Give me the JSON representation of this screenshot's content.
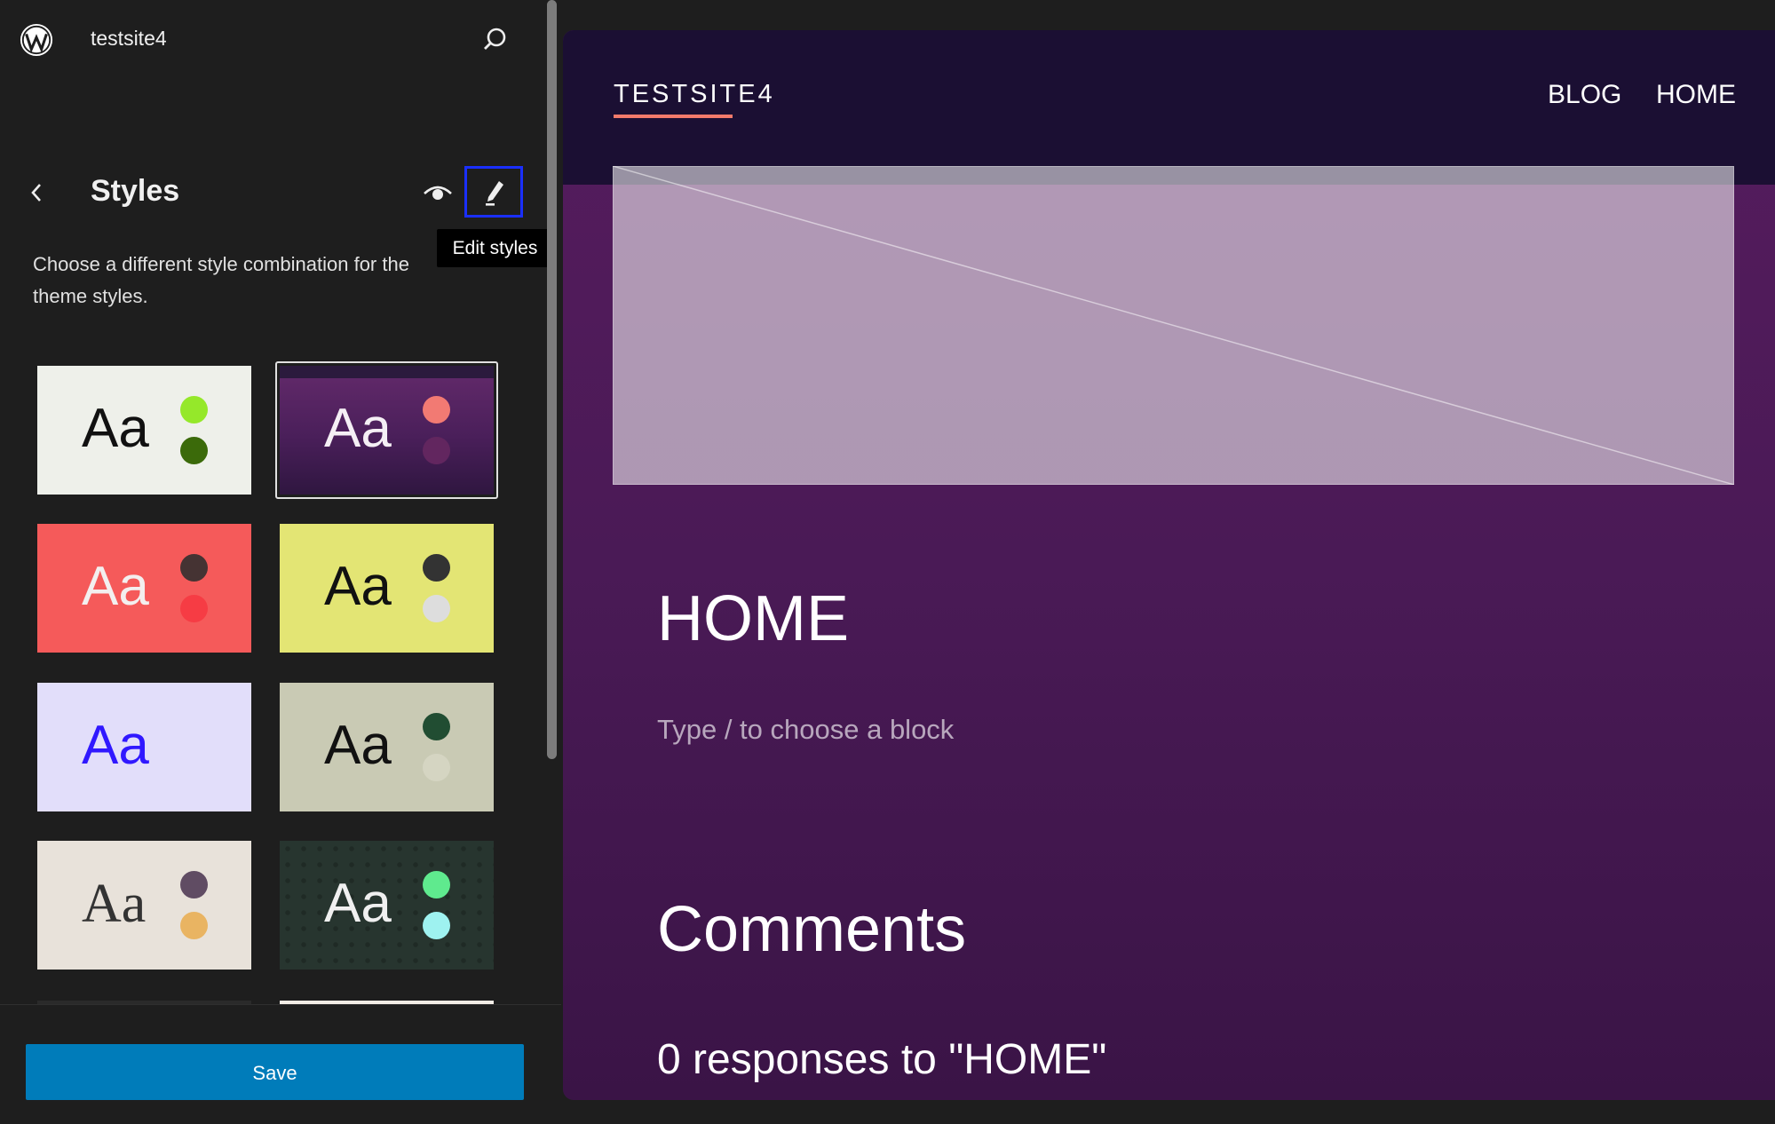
{
  "sidebar": {
    "site_name": "testsite4",
    "title": "Styles",
    "description": "Choose a different style combination for the theme styles.",
    "tooltip": "Edit styles",
    "save_label": "Save",
    "icons": {
      "logo": "wordpress-logo",
      "search": "search-icon",
      "back": "chevron-left-icon",
      "preview": "eye-icon",
      "edit": "pencil-icon"
    },
    "style_variations": [
      {
        "label": "Aa",
        "bg": "#eef0ea",
        "text": "#111111",
        "dots": [
          "#95e82a",
          "#3b6a0a"
        ]
      },
      {
        "label": "Aa",
        "bg": "#4a1f5a",
        "text": "#f5eff5",
        "dots": [
          "#f27a73",
          "#62265f"
        ],
        "selected": true
      },
      {
        "label": "Aa",
        "bg": "#f55a5a",
        "text": "#f3efef",
        "dots": [
          "#453333",
          "#f63c44"
        ]
      },
      {
        "label": "Aa",
        "bg": "#e3e574",
        "text": "#111111",
        "dots": [
          "#333333",
          "#dddddd"
        ]
      },
      {
        "label": "Aa",
        "bg": "#e2defa",
        "text": "#3018ff",
        "dots": []
      },
      {
        "label": "Aa",
        "bg": "#c9cab4",
        "text": "#111111",
        "dots": [
          "#214d32",
          "#d5d5c2"
        ]
      },
      {
        "label": "Aa",
        "bg": "#e8e2da",
        "text": "#333333",
        "dots": [
          "#604c63",
          "#e9b462"
        ],
        "serif": true
      },
      {
        "label": "Aa",
        "bg": "#27352f",
        "text": "#f0f0f0",
        "dots": [
          "#5fea8e",
          "#9ef2f0"
        ],
        "pattern": true
      }
    ]
  },
  "preview": {
    "site_title": "TESTSITE4",
    "nav": [
      "BLOG",
      "HOME"
    ],
    "page_title": "HOME",
    "block_hint": "Type / to choose a block",
    "comments_title": "Comments",
    "responses": "0 responses to \"HOME\"",
    "colors": {
      "header": "#1b0f33",
      "background": "#561c5e",
      "accent": "#f27a6b"
    }
  }
}
